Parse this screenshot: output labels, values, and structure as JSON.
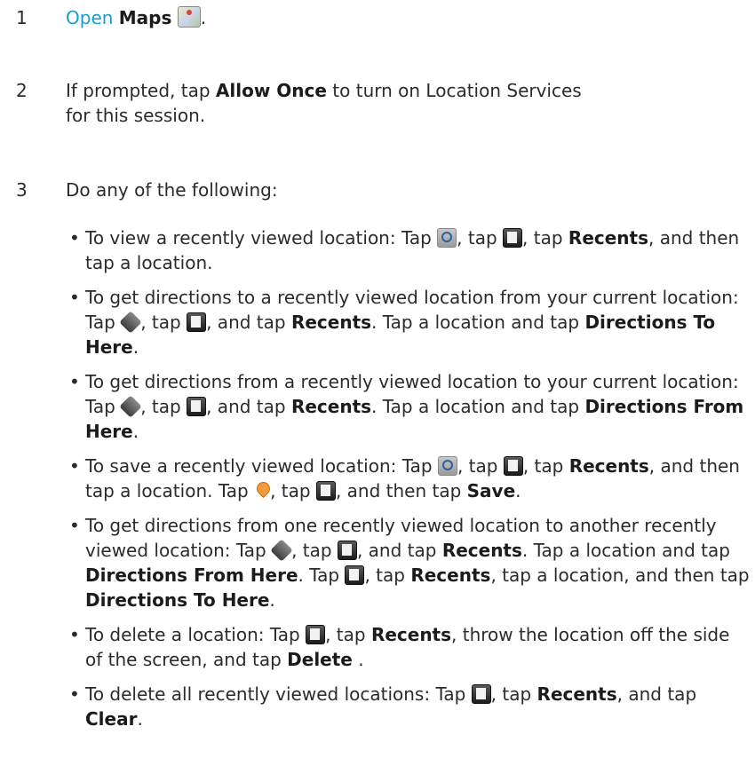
{
  "steps": [
    {
      "number": "1",
      "open_link": "Open",
      "app_name": "Maps",
      "period": ".",
      "icon": "maps-app-icon"
    },
    {
      "number": "2",
      "pre": "If prompted, tap ",
      "bold": "Allow Once",
      "post": " to turn on Location Services for this session."
    },
    {
      "number": "3",
      "text": "Do any of the following:"
    }
  ],
  "bullets": [
    {
      "parts": [
        {
          "t": "To view a recently viewed location: Tap "
        },
        {
          "icon": "search-icon"
        },
        {
          "t": ", tap "
        },
        {
          "icon": "bookmark-icon"
        },
        {
          "t": ", tap "
        },
        {
          "b": "Recents"
        },
        {
          "t": ", and then tap a location."
        }
      ]
    },
    {
      "parts": [
        {
          "t": "To get directions to a recently viewed location from your current location: Tap "
        },
        {
          "icon": "directions-icon"
        },
        {
          "t": ", tap "
        },
        {
          "icon": "bookmark-icon"
        },
        {
          "t": ", and tap "
        },
        {
          "b": "Recents"
        },
        {
          "t": ". Tap a location and tap "
        },
        {
          "b": "Directions To Here"
        },
        {
          "t": "."
        }
      ]
    },
    {
      "parts": [
        {
          "t": "To get directions from a recently viewed location to your current location: Tap "
        },
        {
          "icon": "directions-icon"
        },
        {
          "t": ", tap "
        },
        {
          "icon": "bookmark-icon"
        },
        {
          "t": ", and tap "
        },
        {
          "b": "Recents"
        },
        {
          "t": ". Tap a location and tap "
        },
        {
          "b": "Directions From Here"
        },
        {
          "t": "."
        }
      ]
    },
    {
      "parts": [
        {
          "t": "To save a recently viewed location: Tap "
        },
        {
          "icon": "search-icon"
        },
        {
          "t": ", tap "
        },
        {
          "icon": "bookmark-icon"
        },
        {
          "t": ", tap "
        },
        {
          "b": "Recents"
        },
        {
          "t": ", and then tap a location. Tap "
        },
        {
          "icon": "pin-icon"
        },
        {
          "t": ", tap "
        },
        {
          "icon": "bookmark-icon"
        },
        {
          "t": ", and then tap "
        },
        {
          "b": "Save"
        },
        {
          "t": "."
        }
      ]
    },
    {
      "parts": [
        {
          "t": "To get directions from one recently viewed location to another recently viewed location: Tap "
        },
        {
          "icon": "directions-icon"
        },
        {
          "t": ", tap "
        },
        {
          "icon": "bookmark-icon"
        },
        {
          "t": ", and tap "
        },
        {
          "b": "Recents"
        },
        {
          "t": ". Tap a location and tap "
        },
        {
          "b": "Directions From Here"
        },
        {
          "t": ". Tap "
        },
        {
          "icon": "bookmark-icon"
        },
        {
          "t": ", tap "
        },
        {
          "b": "Recents"
        },
        {
          "t": ", tap a location, and then tap "
        },
        {
          "b": "Directions To Here"
        },
        {
          "t": "."
        }
      ]
    },
    {
      "parts": [
        {
          "t": "To delete a location: Tap "
        },
        {
          "icon": "bookmark-icon"
        },
        {
          "t": ", tap "
        },
        {
          "b": "Recents"
        },
        {
          "t": ", throw the location off the side of the screen, and tap "
        },
        {
          "b": "Delete"
        },
        {
          "t": " ."
        }
      ]
    },
    {
      "parts": [
        {
          "t": "To delete all recently viewed locations: Tap "
        },
        {
          "icon": "bookmark-icon"
        },
        {
          "t": ", tap "
        },
        {
          "b": "Recents"
        },
        {
          "t": ", and tap "
        },
        {
          "b": "Clear"
        },
        {
          "t": "."
        }
      ]
    }
  ],
  "colors": {
    "link": "#1a9ccf",
    "text": "#2b2b2b",
    "pin": "#f39a3c"
  }
}
